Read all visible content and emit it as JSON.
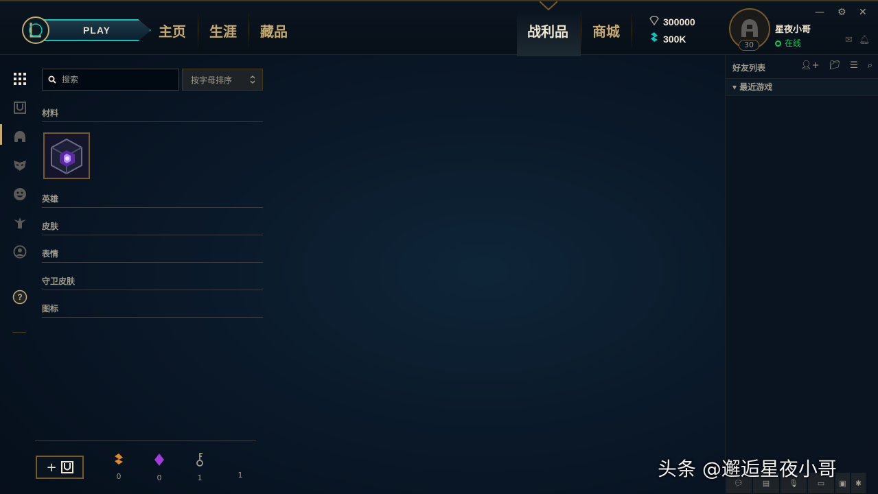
{
  "header": {
    "play_label": "PLAY",
    "nav": [
      "主页",
      "生涯",
      "藏品",
      "战利品",
      "商城"
    ],
    "active_nav": "战利品",
    "currency": {
      "blue_essence": "300000",
      "riot_points": "300K"
    },
    "profile": {
      "name": "星夜小哥",
      "status": "在线",
      "level": "30"
    }
  },
  "leftnav": {
    "icons": [
      "grid-icon",
      "chest-icon",
      "champion-helmet-icon",
      "mask-icon",
      "emote-smile-icon",
      "ward-icon",
      "profile-icon",
      "help-icon"
    ]
  },
  "loot": {
    "search_placeholder": "搜索",
    "sort_label": "按字母排序",
    "sections": {
      "materials": "材料",
      "champions": "英雄",
      "skins": "皮肤",
      "emotes": "表情",
      "ward_skins": "守卫皮肤",
      "icons": "图标"
    },
    "bottom_currencies": [
      {
        "icon": "orange-essence-icon",
        "count": "0"
      },
      {
        "icon": "mythic-essence-icon",
        "count": "0"
      },
      {
        "icon": "key-fragment-icon",
        "count": "1"
      },
      {
        "icon": "key-icon",
        "count": "1"
      }
    ]
  },
  "social": {
    "title": "好友列表",
    "section": "最近游戏"
  },
  "watermark": "头条 @邂逅星夜小哥",
  "colors": {
    "gold": "#c8aa6e",
    "teal": "#0ac8b9",
    "online": "#0acb5a",
    "background": "#0a1828"
  }
}
